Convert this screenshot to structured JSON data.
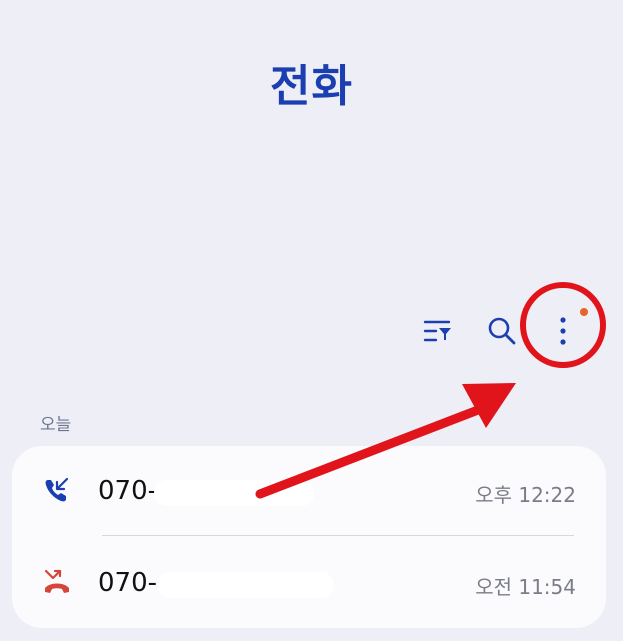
{
  "header": {
    "title": "전화"
  },
  "toolbar": {
    "filter_icon": "filter-list-icon",
    "search_icon": "search-icon",
    "more_icon": "more-vertical-icon",
    "badge_color": "#e8622a",
    "icon_color": "#1b3fb0"
  },
  "recents": {
    "section_label": "오늘",
    "calls": [
      {
        "type": "incoming",
        "icon": "incoming-call-icon",
        "icon_color": "#1b3fb0",
        "number": "070-",
        "time": "오후 12:22"
      },
      {
        "type": "missed",
        "icon": "missed-call-icon",
        "icon_color": "#d6453a",
        "number": "070-",
        "time": "오전 11:54"
      }
    ]
  },
  "annotation": {
    "color": "#e0141a"
  }
}
